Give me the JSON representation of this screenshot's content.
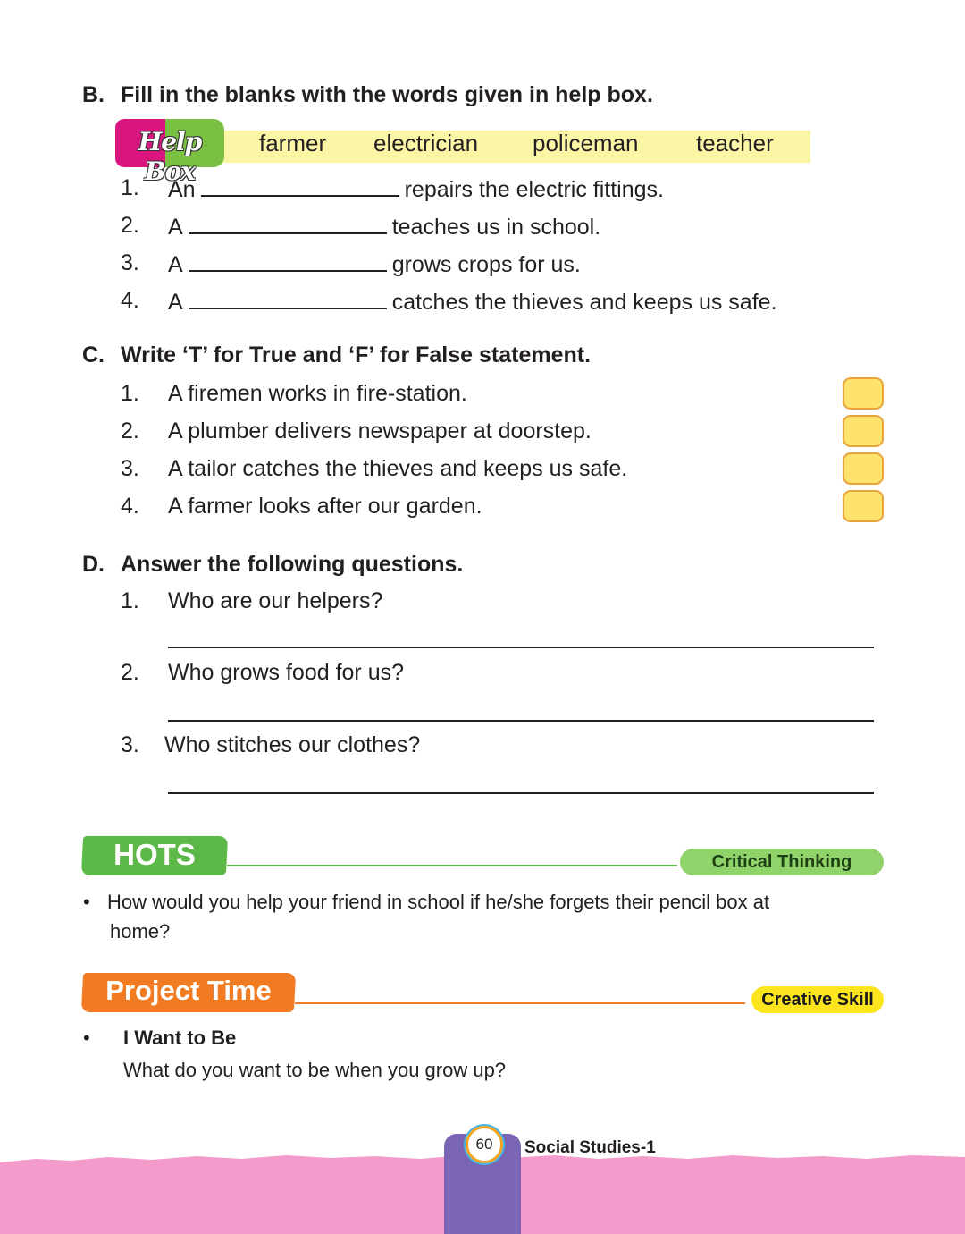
{
  "section_b": {
    "letter": "B.",
    "heading": "Fill in the blanks with the words given in help box.",
    "help_box": {
      "logo_text": "Help Box",
      "words": [
        "farmer",
        "electrician",
        "policeman",
        "teacher"
      ]
    },
    "items": [
      {
        "num": "1.",
        "before": "An",
        "after": "repairs the electric fittings."
      },
      {
        "num": "2.",
        "before": "A",
        "after": "teaches us in school."
      },
      {
        "num": "3.",
        "before": "A",
        "after": "grows crops for us."
      },
      {
        "num": "4.",
        "before": "A",
        "after": "catches the thieves and keeps us safe."
      }
    ]
  },
  "section_c": {
    "letter": "C.",
    "heading": "Write ‘T’ for True and ‘F’ for False statement.",
    "items": [
      {
        "num": "1.",
        "text": "A firemen works in fire-station."
      },
      {
        "num": "2.",
        "text": "A plumber delivers newspaper at doorstep."
      },
      {
        "num": "3.",
        "text": "A tailor catches the thieves and keeps us safe."
      },
      {
        "num": "4.",
        "text": "A farmer looks after our garden."
      }
    ]
  },
  "section_d": {
    "letter": "D.",
    "heading": "Answer the following questions.",
    "items": [
      {
        "num": "1.",
        "text": "Who are our helpers?"
      },
      {
        "num": "2.",
        "text": "Who grows food for us?"
      },
      {
        "num": "3.",
        "text": "Who stitches our clothes?"
      }
    ]
  },
  "hots": {
    "title": "HOTS",
    "tag": "Critical Thinking",
    "bullet": "•",
    "line1": "How would you help your friend in school if he/she  forgets their pencil box at",
    "line2": "home?"
  },
  "project": {
    "title": "Project Time",
    "tag": "Creative Skill",
    "bullet": "•",
    "subtitle": "I Want to Be",
    "question": "What do you want to be when you grow up?"
  },
  "footer": {
    "page_number": "60",
    "book_title": "Social Studies-1"
  },
  "colors": {
    "hots_green": "#5cb847",
    "hots_tag_green": "#8fd36a",
    "project_orange": "#f07b22",
    "project_tag_yellow": "#fce51e",
    "footer_pink": "#f59bcb",
    "footer_tab_purple": "#7965b4",
    "helpbox_magenta": "#d9157f",
    "helpbox_green": "#7ac143",
    "helpbar_yellow": "#fbf6a6"
  }
}
